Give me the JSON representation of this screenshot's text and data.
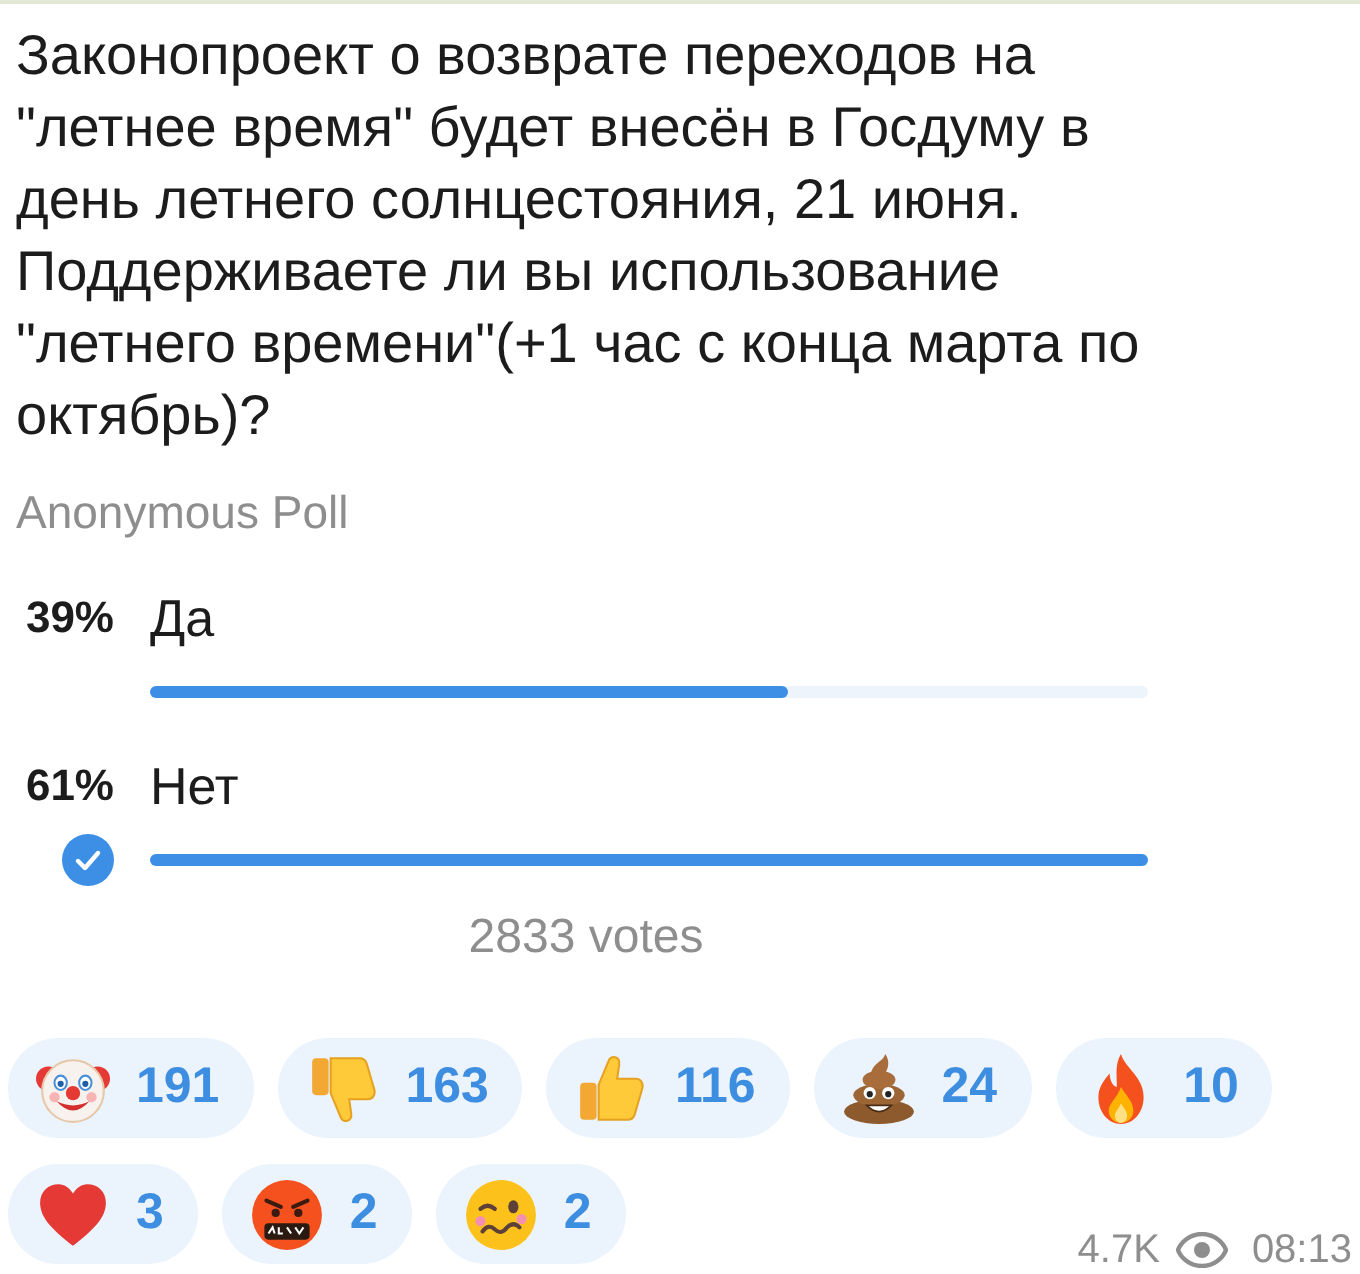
{
  "question": "Законопроект о возврате переходов на \"летнее время\" будет внесён в Госдуму в день летнего солнцестояния, 21 июня. Поддерживаете ли вы использование \"летнего времени\"(+1 час с конца марта по октябрь)?",
  "poll_type": "Anonymous Poll",
  "options": [
    {
      "percent": "39%",
      "text": "Да",
      "selected": false,
      "level": 0.64
    },
    {
      "percent": "61%",
      "text": "Нет",
      "selected": true,
      "level": 1
    }
  ],
  "total_votes": "2833 votes",
  "reactions": [
    {
      "kind": "clown",
      "count": "191"
    },
    {
      "kind": "thumbs_down",
      "count": "163"
    },
    {
      "kind": "thumbs_up",
      "count": "116"
    },
    {
      "kind": "poop",
      "count": "24"
    },
    {
      "kind": "fire",
      "count": "10"
    },
    {
      "kind": "heart",
      "count": "3"
    },
    {
      "kind": "angry",
      "count": "2"
    },
    {
      "kind": "woozy",
      "count": "2"
    }
  ],
  "views": "4.7K",
  "time": "08:13"
}
